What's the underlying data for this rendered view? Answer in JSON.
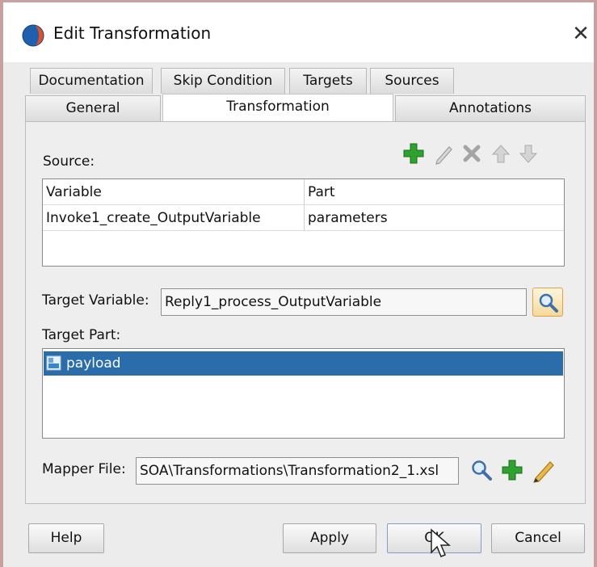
{
  "window": {
    "title": "Edit Transformation",
    "close_glyph": "✕"
  },
  "tabs_row1": [
    {
      "label": "Documentation"
    },
    {
      "label": "Skip Condition"
    },
    {
      "label": "Targets"
    },
    {
      "label": "Sources"
    }
  ],
  "tabs_row2": [
    {
      "label": "General"
    },
    {
      "label": "Transformation",
      "active": true
    },
    {
      "label": "Annotations"
    }
  ],
  "source": {
    "label": "Source:",
    "toolbar_icons": [
      "add-icon",
      "edit-icon",
      "delete-icon",
      "move-up-icon",
      "move-down-icon"
    ],
    "columns": [
      "Variable",
      "Part"
    ],
    "rows": [
      [
        "Invoke1_create_OutputVariable",
        "parameters"
      ]
    ]
  },
  "target_variable": {
    "label": "Target Variable:",
    "value": "Reply1_process_OutputVariable"
  },
  "target_part": {
    "label": "Target Part:",
    "items": [
      {
        "label": "payload",
        "selected": true
      }
    ]
  },
  "mapper_file": {
    "label": "Mapper File:",
    "value": "SOA\\Transformations\\Transformation2_1.xsl"
  },
  "buttons": {
    "help": "Help",
    "apply": "Apply",
    "ok": "OK",
    "cancel": "Cancel"
  },
  "colors": {
    "selection": "#2b6cab",
    "add_green": "#2ea12e",
    "accent_orange": "#e0a040"
  }
}
